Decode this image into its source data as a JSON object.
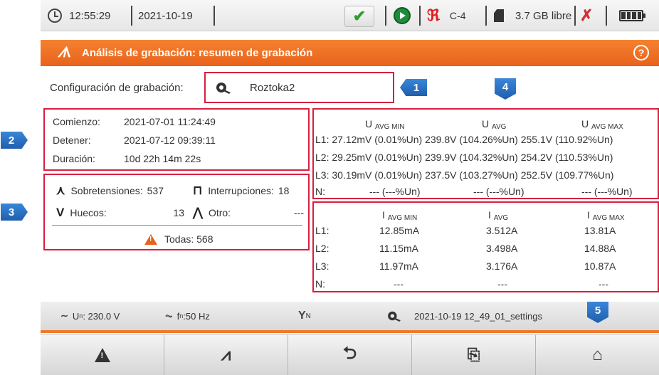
{
  "statusbar": {
    "time": "12:55:29",
    "date": "2021-10-19",
    "clamp_label": "C-4",
    "storage": "3.7 GB libre"
  },
  "titlebar": {
    "title": "Análisis de grabación: resumen de grabación"
  },
  "config": {
    "label": "Configuración de grabación:",
    "value": "Roztoka2"
  },
  "markers": {
    "m1": "1",
    "m2": "2",
    "m3": "3",
    "m4": "4",
    "m5": "5"
  },
  "times": [
    {
      "label": "Comienzo:",
      "value": "2021-07-01 11:24:49"
    },
    {
      "label": "Detener:",
      "value": "2021-07-12 09:39:11"
    },
    {
      "label": "Duración:",
      "value": "10d 22h 14m 22s"
    }
  ],
  "events": {
    "overvoltage_label": "Sobretensiones:",
    "overvoltage_count": "537",
    "interruptions_label": "Interrupciones:",
    "interruptions_count": "18",
    "dips_label": "Huecos:",
    "dips_count": "13",
    "other_label": "Otro:",
    "other_count": "---",
    "total_label": "Todas: 568"
  },
  "voltage": {
    "headers": [
      {
        "main": "U",
        "sub": "AVG MIN"
      },
      {
        "main": "U",
        "sub": "AVG"
      },
      {
        "main": "U",
        "sub": "AVG MAX"
      }
    ],
    "rows": [
      "L1: 27.12mV (0.01%Un) 239.8V (104.26%Un) 255.1V (110.92%Un)",
      "L2: 29.25mV (0.01%Un) 239.9V (104.32%Un) 254.2V (110.53%Un)",
      "L3: 30.19mV (0.01%Un) 237.5V (103.27%Un) 252.5V (109.77%Un)"
    ],
    "n_row": {
      "label": "N:",
      "min": "--- (---%Un)",
      "avg": "--- (---%Un)",
      "max": "--- (---%Un)"
    }
  },
  "current": {
    "headers": [
      {
        "main": "I",
        "sub": "AVG MIN"
      },
      {
        "main": "I",
        "sub": "AVG"
      },
      {
        "main": "I",
        "sub": "AVG MAX"
      }
    ],
    "rows": [
      {
        "label": "L1:",
        "min": "12.85mA",
        "avg": "3.512A",
        "max": "13.81A"
      },
      {
        "label": "L2:",
        "min": "11.15mA",
        "avg": "3.498A",
        "max": "14.88A"
      },
      {
        "label": "L3:",
        "min": "11.97mA",
        "avg": "3.176A",
        "max": "10.87A"
      },
      {
        "label": "N:",
        "min": "---",
        "avg": "---",
        "max": "---"
      }
    ]
  },
  "infobar": {
    "un_label": "U",
    "un_sub": "n",
    "un_value": ": 230.0 V",
    "fn_label": "f",
    "fn_sub": "n",
    "fn_value": ":50 Hz",
    "network_sub": "N",
    "settings_file": "2021-10-19 12_49_01_settings"
  }
}
